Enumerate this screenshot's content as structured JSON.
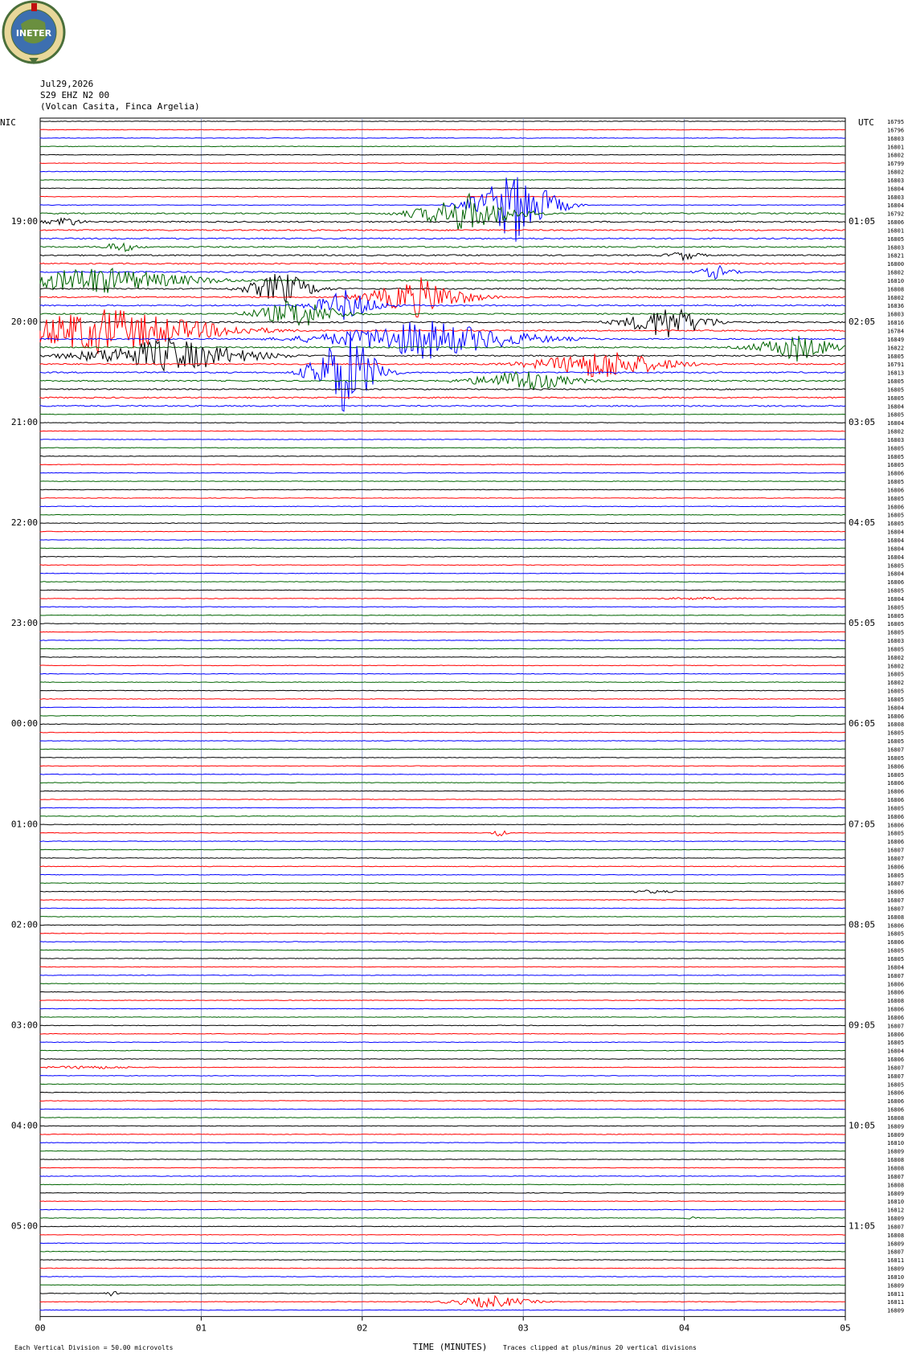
{
  "logo": {
    "text": "INETER",
    "colors": {
      "ring": "#4a6f3a",
      "fill": "#e8d79a",
      "globe": "#3d6fb0",
      "land": "#6a8f3f",
      "flag": "#c01010"
    }
  },
  "header": {
    "date": "Jul29,2026",
    "station": "S29 EHZ N2 00",
    "location": "(Volcan Casita, Finca Argelia)"
  },
  "labels": {
    "left_tz": "NIC",
    "right_tz": "UTC",
    "scale": "Each Vertical Division =   50.00 microvolts",
    "clip": "Traces clipped at plus/minus 20 vertical divisions",
    "x_axis": "TIME (MINUTES)"
  },
  "chart_data": {
    "type": "line",
    "title": "",
    "xlabel": "TIME (MINUTES)",
    "x_ticks": [
      "00",
      "01",
      "02",
      "03",
      "04",
      "05"
    ],
    "xlim": [
      0,
      5
    ],
    "trace_colors": [
      "#000000",
      "#ff0000",
      "#0000ff",
      "#006400"
    ],
    "left_hour_labels": [
      "19:00",
      "20:00",
      "21:00",
      "22:00",
      "23:00",
      "00:00",
      "01:00",
      "02:00",
      "03:00",
      "04:00",
      "05:00"
    ],
    "right_hour_labels": [
      "01:05",
      "02:05",
      "03:05",
      "04:05",
      "05:05",
      "06:05",
      "07:05",
      "08:05",
      "09:05",
      "10:05",
      "11:05"
    ],
    "right_counts": [
      "16795",
      "16796",
      "16803",
      "16801",
      "16802",
      "16799",
      "16802",
      "16803",
      "16804",
      "16803",
      "16804",
      "16792",
      "16806",
      "16801",
      "16805",
      "16803",
      "16821",
      "16800",
      "16802",
      "16810",
      "16808",
      "16802",
      "16836",
      "16803",
      "16816",
      "16784",
      "16849",
      "16822",
      "16805",
      "16791",
      "16813",
      "16805",
      "16805",
      "16805",
      "16804",
      "16805",
      "16804",
      "16802",
      "16803",
      "16805",
      "16805",
      "16805",
      "16806",
      "16805",
      "16806",
      "16805",
      "16806",
      "16805",
      "16805",
      "16804",
      "16804",
      "16804",
      "16804",
      "16805",
      "16804",
      "16806",
      "16805",
      "16804",
      "16805",
      "16805",
      "16805",
      "16805",
      "16803",
      "16805",
      "16802",
      "16802",
      "16805",
      "16802",
      "16805",
      "16805",
      "16804",
      "16806",
      "16808",
      "16805",
      "16805",
      "16807",
      "16805",
      "16806",
      "16805",
      "16806",
      "16806",
      "16806",
      "16805",
      "16806",
      "16806",
      "16805",
      "16806",
      "16807",
      "16807",
      "16806",
      "16805",
      "16807",
      "16806",
      "16807",
      "16807",
      "16808",
      "16806",
      "16805",
      "16806",
      "16805",
      "16805",
      "16804",
      "16807",
      "16806",
      "16806",
      "16808",
      "16806",
      "16806",
      "16807",
      "16806",
      "16805",
      "16804",
      "16806",
      "16807",
      "16807",
      "16805",
      "16806",
      "16806",
      "16806",
      "16808",
      "16809",
      "16809",
      "16810",
      "16809",
      "16808",
      "16808",
      "16807",
      "16808",
      "16809",
      "16810",
      "16812",
      "16809",
      "16807",
      "16808",
      "16809",
      "16807",
      "16811",
      "16809",
      "16810",
      "16809",
      "16811",
      "16811",
      "16809"
    ],
    "series": [
      {
        "row": 10,
        "at": 2.95,
        "amp": 95,
        "dur": 0.5
      },
      {
        "row": 11,
        "at": 2.65,
        "amp": 50,
        "dur": 0.6
      },
      {
        "row": 12,
        "at": 0.15,
        "amp": 14,
        "dur": 0.2
      },
      {
        "row": 15,
        "at": 0.5,
        "amp": 14,
        "dur": 0.2
      },
      {
        "row": 16,
        "at": 4.0,
        "amp": 12,
        "dur": 0.2
      },
      {
        "row": 18,
        "at": 4.2,
        "amp": 18,
        "dur": 0.2
      },
      {
        "row": 19,
        "at": 0.35,
        "amp": 35,
        "dur": 1.2
      },
      {
        "row": 20,
        "at": 1.5,
        "amp": 45,
        "dur": 0.4
      },
      {
        "row": 21,
        "at": 2.35,
        "amp": 50,
        "dur": 0.6
      },
      {
        "row": 22,
        "at": 1.9,
        "amp": 40,
        "dur": 0.4
      },
      {
        "row": 23,
        "at": 1.6,
        "amp": 40,
        "dur": 0.5
      },
      {
        "row": 24,
        "at": 3.9,
        "amp": 45,
        "dur": 0.5
      },
      {
        "row": 25,
        "at": 0.4,
        "amp": 60,
        "dur": 1.4
      },
      {
        "row": 26,
        "at": 2.4,
        "amp": 50,
        "dur": 1.2
      },
      {
        "row": 27,
        "at": 4.7,
        "amp": 35,
        "dur": 0.5
      },
      {
        "row": 28,
        "at": 0.8,
        "amp": 45,
        "dur": 1.0
      },
      {
        "row": 29,
        "at": 3.5,
        "amp": 40,
        "dur": 0.8
      },
      {
        "row": 30,
        "at": 1.9,
        "amp": 120,
        "dur": 0.4
      },
      {
        "row": 31,
        "at": 3.0,
        "amp": 30,
        "dur": 0.6
      },
      {
        "row": 57,
        "at": 4.1,
        "amp": 3,
        "dur": 0.6
      },
      {
        "row": 85,
        "at": 2.85,
        "amp": 10,
        "dur": 0.1
      },
      {
        "row": 92,
        "at": 3.8,
        "amp": 4,
        "dur": 0.3
      },
      {
        "row": 113,
        "at": 0.3,
        "amp": 4,
        "dur": 0.6
      },
      {
        "row": 131,
        "at": 4.05,
        "amp": 4,
        "dur": 0.1
      },
      {
        "row": 140,
        "at": 0.45,
        "amp": 9,
        "dur": 0.08
      },
      {
        "row": 141,
        "at": 2.8,
        "amp": 16,
        "dur": 0.5
      }
    ]
  }
}
